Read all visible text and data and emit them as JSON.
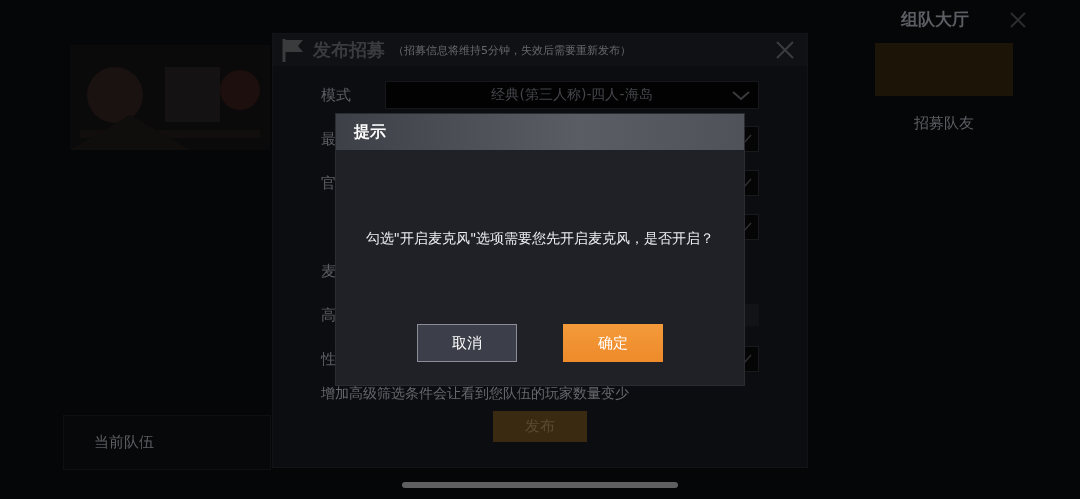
{
  "lobby": {
    "title": "组队大厅",
    "recruit_label": "招募队友",
    "current_team": "当前队伍"
  },
  "publish_panel": {
    "title": "发布招募",
    "subtitle": "（招募信息将维持5分钟，失效后需要重新发布）",
    "rows": [
      {
        "label": "模式",
        "kind": "dropdown",
        "value": "经典(第三人称)-四人-海岛"
      },
      {
        "label": "最",
        "kind": "check",
        "checked": true
      },
      {
        "label": "官",
        "kind": "check",
        "checked": true
      },
      {
        "kind": "check",
        "checked": true
      },
      {
        "label": "麦",
        "kind": "blank"
      },
      {
        "label": "高",
        "kind": "bar"
      },
      {
        "label": "性",
        "kind": "check",
        "checked": true
      }
    ],
    "note": "增加高级筛选条件会让看到您队伍的玩家数量变少",
    "publish_button": "发布"
  },
  "dialog": {
    "title": "提示",
    "message": "勾选\"开启麦克风\"选项需要您先开启麦克风，是否开启？",
    "buttons": [
      {
        "label": "取消",
        "kind": "cancel"
      },
      {
        "label": "确定",
        "kind": "confirm"
      }
    ]
  }
}
